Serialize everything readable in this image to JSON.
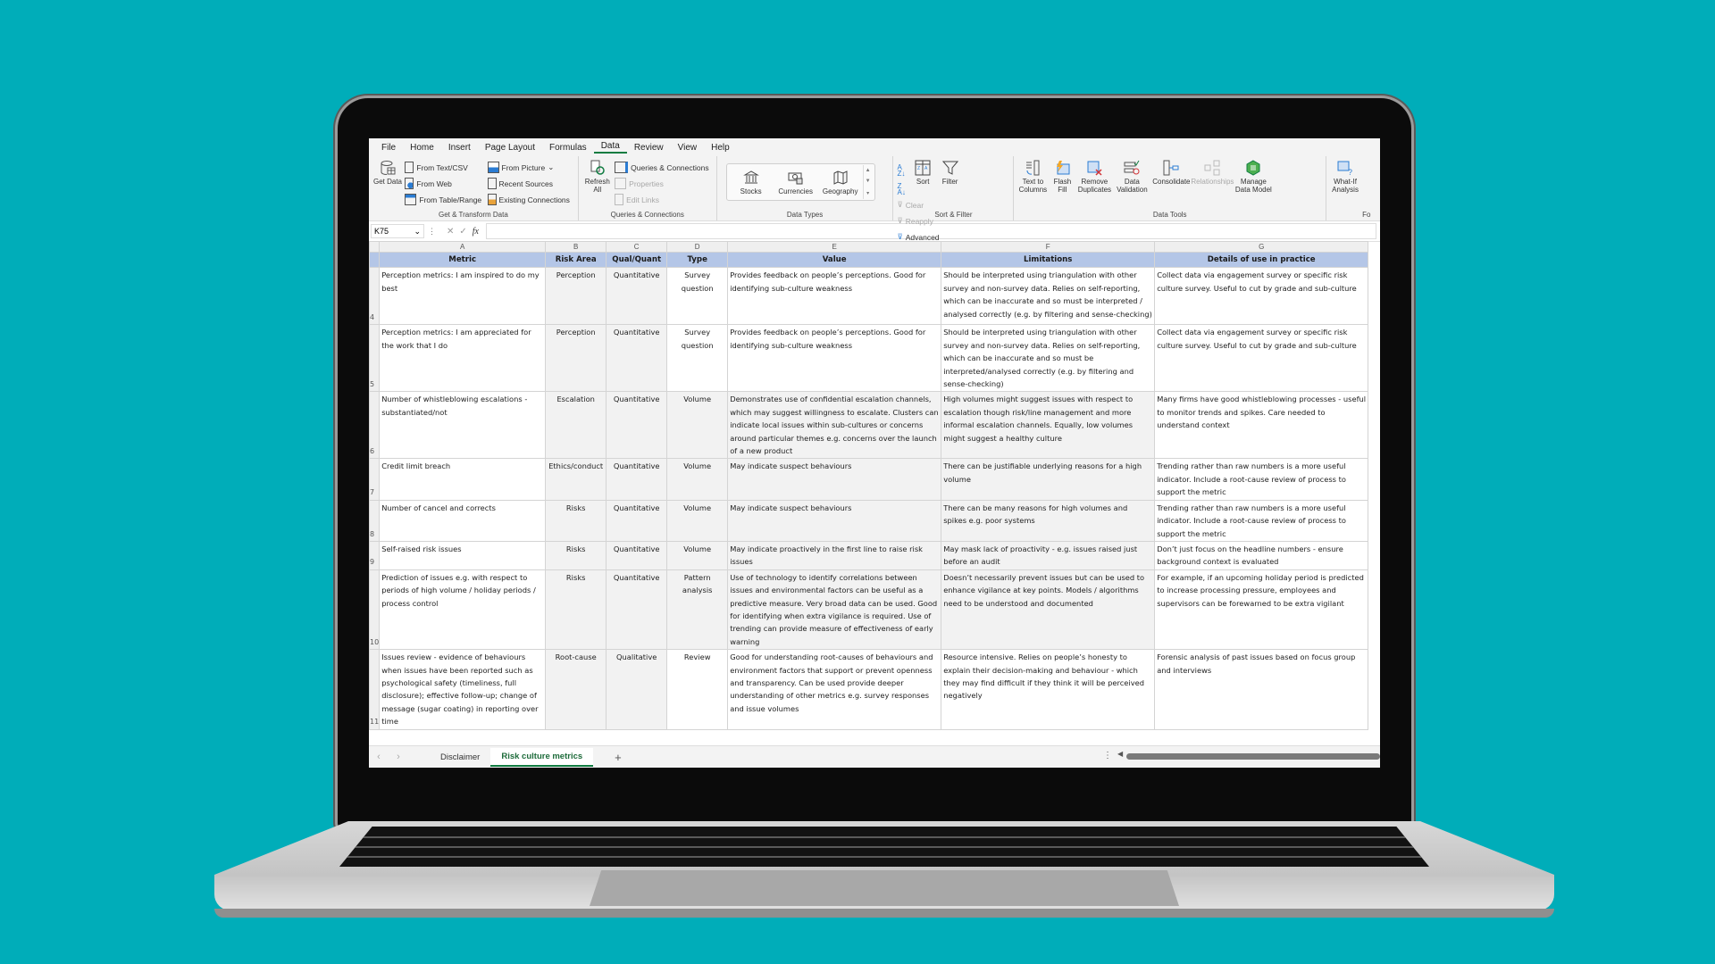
{
  "background_color": "#00adb9",
  "menu": {
    "items": [
      "File",
      "Home",
      "Insert",
      "Page Layout",
      "Formulas",
      "Data",
      "Review",
      "View",
      "Help"
    ],
    "active": "Data"
  },
  "ribbon": {
    "get_transform": {
      "get_data": "Get Data",
      "from_text_csv": "From Text/CSV",
      "from_web": "From Web",
      "from_table_range": "From Table/Range",
      "from_picture": "From Picture",
      "recent_sources": "Recent Sources",
      "existing_connections": "Existing Connections",
      "label": "Get & Transform Data"
    },
    "queries": {
      "refresh_all": "Refresh All",
      "queries_connections": "Queries & Connections",
      "properties": "Properties",
      "edit_links": "Edit Links",
      "label": "Queries & Connections"
    },
    "data_types": {
      "stocks": "Stocks",
      "currencies": "Currencies",
      "geography": "Geography",
      "label": "Data Types"
    },
    "sort_filter": {
      "sort": "Sort",
      "filter": "Filter",
      "clear": "Clear",
      "reapply": "Reapply",
      "advanced": "Advanced",
      "label": "Sort & Filter"
    },
    "data_tools": {
      "text_to_columns": "Text to Columns",
      "flash_fill": "Flash Fill",
      "remove_duplicates": "Remove Duplicates",
      "data_validation": "Data Validation",
      "consolidate": "Consolidate",
      "relationships": "Relationships",
      "manage_data_model": "Manage Data Model",
      "label": "Data Tools"
    },
    "forecast": {
      "what_if": "What-If Analysis",
      "label": "Fo"
    }
  },
  "formula_bar": {
    "name_box": "K75",
    "fx": "fx",
    "value": ""
  },
  "columns": [
    "A",
    "B",
    "C",
    "D",
    "E",
    "F",
    "G"
  ],
  "headers": [
    "Metric",
    "Risk Area",
    "Qual/Quant",
    "Type",
    "Value",
    "Limitations",
    "Details of use in practice"
  ],
  "rows": [
    {
      "num": "4",
      "cells": [
        "Perception metrics: I am inspired to do my best",
        "Perception",
        "Quantitative",
        "Survey question",
        "Provides feedback on people’s perceptions. Good for identifying sub-culture weakness",
        "Should be interpreted using triangulation with other survey and non-survey data. Relies on self-reporting, which can be inaccurate and so must be interpreted / analysed correctly (e.g. by filtering and sense-checking)",
        "Collect data via engagement survey or specific risk culture survey. Useful to cut by grade and sub-culture"
      ]
    },
    {
      "num": "5",
      "cells": [
        "Perception metrics: I am appreciated for the work that I do",
        "Perception",
        "Quantitative",
        "Survey question",
        "Provides feedback on people’s perceptions. Good for identifying sub-culture weakness",
        "Should be interpreted using triangulation with other survey and non-survey data. Relies on self-reporting, which can be inaccurate and so must be interpreted/analysed correctly (e.g. by filtering and sense-checking)",
        "Collect data via engagement survey or specific risk culture survey. Useful to cut by grade and sub-culture"
      ]
    },
    {
      "num": "6",
      "cells": [
        "Number of whistleblowing escalations - substantiated/not",
        "Escalation",
        "Quantitative",
        "Volume",
        "Demonstrates use of confidential escalation channels, which may suggest willingness to escalate. Clusters can indicate local issues within sub-cultures or concerns around particular themes e.g. concerns over the launch of a new product",
        "High volumes might suggest issues with respect to escalation though risk/line management and more informal escalation channels. Equally, low volumes might suggest a healthy culture",
        "Many firms have good whistleblowing processes - useful to monitor trends and spikes. Care needed to understand context"
      ]
    },
    {
      "num": "7",
      "cells": [
        "Credit limit breach",
        "Ethics/conduct",
        "Quantitative",
        "Volume",
        "May indicate suspect behaviours",
        "There can be justifiable underlying reasons for a high volume",
        "Trending rather than raw numbers is a more useful indicator. Include a root-cause review of process to support the metric"
      ]
    },
    {
      "num": "8",
      "cells": [
        "Number of cancel and corrects",
        "Risks",
        "Quantitative",
        "Volume",
        "May indicate suspect behaviours",
        "There can be many reasons for high volumes and spikes e.g. poor systems",
        "Trending rather than raw numbers is a more useful indicator. Include a root-cause review of process to support the metric"
      ]
    },
    {
      "num": "9",
      "cells": [
        "Self-raised risk issues",
        "Risks",
        "Quantitative",
        "Volume",
        "May indicate proactively in the first line to raise risk issues",
        "May mask lack of proactivity - e.g. issues raised just before an audit",
        "Don’t just focus on the headline numbers - ensure background context is evaluated"
      ]
    },
    {
      "num": "10",
      "cells": [
        "Prediction of issues e.g. with respect to periods of high volume / holiday periods / process control",
        "Risks",
        "Quantitative",
        "Pattern analysis",
        "Use of  technology to identify correlations between issues and environmental factors can be useful as a predictive measure. Very broad data can be used. Good for identifying when extra vigilance is required. Use of trending can provide measure of effectiveness of early warning",
        "Doesn’t necessarily prevent issues but can be used to enhance vigilance at key points. Models / algorithms need to be understood and documented",
        "For example, if an upcoming holiday period is predicted to increase processing pressure, employees and supervisors can be forewarned to be extra vigilant"
      ]
    },
    {
      "num": "11",
      "cells": [
        "Issues review - evidence of behaviours when issues have been reported such as psychological safety (timeliness, full disclosure); effective follow-up; change of message  (sugar coating) in reporting over time",
        "Root-cause",
        "Qualitative",
        "Review",
        "Good for understanding root-causes of behaviours and environment factors that support or prevent openness and transparency. Can be used provide deeper understanding of other metrics e.g. survey responses and issue volumes",
        "Resource intensive. Relies on people’s honesty to explain their decision-making and behaviour - which they may find difficult if they think it will be perceived negatively",
        "Forensic analysis of past issues based on focus group and interviews"
      ]
    }
  ],
  "sheet_tabs": [
    {
      "label": "Disclaimer",
      "active": false
    },
    {
      "label": "Risk culture metrics",
      "active": true
    }
  ],
  "add_sheet": "+"
}
